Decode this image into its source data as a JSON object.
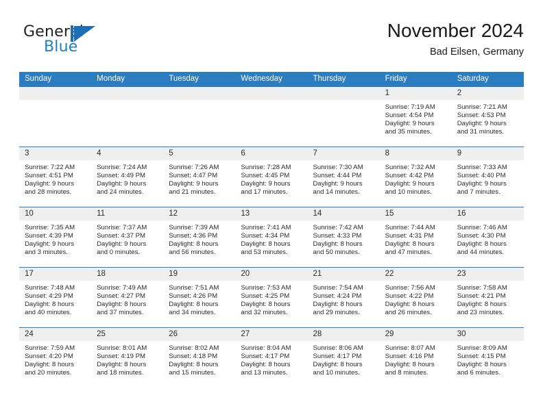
{
  "brand": {
    "name_part1": "General",
    "name_part2": "Blue",
    "mark": "triangle-flag-logo"
  },
  "header": {
    "title": "November 2024",
    "subtitle": "Bad Eilsen, Germany"
  },
  "colors": {
    "header_blue": "#2c7cc0",
    "day_header_gray": "#efefef",
    "brand_blue": "#1c7fc4",
    "text": "#2a2a2a"
  },
  "weekday_headers": [
    "Sunday",
    "Monday",
    "Tuesday",
    "Wednesday",
    "Thursday",
    "Friday",
    "Saturday"
  ],
  "weeks": [
    [
      {
        "date": "",
        "lines": []
      },
      {
        "date": "",
        "lines": []
      },
      {
        "date": "",
        "lines": []
      },
      {
        "date": "",
        "lines": []
      },
      {
        "date": "",
        "lines": []
      },
      {
        "date": "1",
        "lines": [
          "Sunrise: 7:19 AM",
          "Sunset: 4:54 PM",
          "Daylight: 9 hours",
          "and 35 minutes."
        ]
      },
      {
        "date": "2",
        "lines": [
          "Sunrise: 7:21 AM",
          "Sunset: 4:53 PM",
          "Daylight: 9 hours",
          "and 31 minutes."
        ]
      }
    ],
    [
      {
        "date": "3",
        "lines": [
          "Sunrise: 7:22 AM",
          "Sunset: 4:51 PM",
          "Daylight: 9 hours",
          "and 28 minutes."
        ]
      },
      {
        "date": "4",
        "lines": [
          "Sunrise: 7:24 AM",
          "Sunset: 4:49 PM",
          "Daylight: 9 hours",
          "and 24 minutes."
        ]
      },
      {
        "date": "5",
        "lines": [
          "Sunrise: 7:26 AM",
          "Sunset: 4:47 PM",
          "Daylight: 9 hours",
          "and 21 minutes."
        ]
      },
      {
        "date": "6",
        "lines": [
          "Sunrise: 7:28 AM",
          "Sunset: 4:45 PM",
          "Daylight: 9 hours",
          "and 17 minutes."
        ]
      },
      {
        "date": "7",
        "lines": [
          "Sunrise: 7:30 AM",
          "Sunset: 4:44 PM",
          "Daylight: 9 hours",
          "and 14 minutes."
        ]
      },
      {
        "date": "8",
        "lines": [
          "Sunrise: 7:32 AM",
          "Sunset: 4:42 PM",
          "Daylight: 9 hours",
          "and 10 minutes."
        ]
      },
      {
        "date": "9",
        "lines": [
          "Sunrise: 7:33 AM",
          "Sunset: 4:40 PM",
          "Daylight: 9 hours",
          "and 7 minutes."
        ]
      }
    ],
    [
      {
        "date": "10",
        "lines": [
          "Sunrise: 7:35 AM",
          "Sunset: 4:39 PM",
          "Daylight: 9 hours",
          "and 3 minutes."
        ]
      },
      {
        "date": "11",
        "lines": [
          "Sunrise: 7:37 AM",
          "Sunset: 4:37 PM",
          "Daylight: 9 hours",
          "and 0 minutes."
        ]
      },
      {
        "date": "12",
        "lines": [
          "Sunrise: 7:39 AM",
          "Sunset: 4:36 PM",
          "Daylight: 8 hours",
          "and 56 minutes."
        ]
      },
      {
        "date": "13",
        "lines": [
          "Sunrise: 7:41 AM",
          "Sunset: 4:34 PM",
          "Daylight: 8 hours",
          "and 53 minutes."
        ]
      },
      {
        "date": "14",
        "lines": [
          "Sunrise: 7:42 AM",
          "Sunset: 4:33 PM",
          "Daylight: 8 hours",
          "and 50 minutes."
        ]
      },
      {
        "date": "15",
        "lines": [
          "Sunrise: 7:44 AM",
          "Sunset: 4:31 PM",
          "Daylight: 8 hours",
          "and 47 minutes."
        ]
      },
      {
        "date": "16",
        "lines": [
          "Sunrise: 7:46 AM",
          "Sunset: 4:30 PM",
          "Daylight: 8 hours",
          "and 44 minutes."
        ]
      }
    ],
    [
      {
        "date": "17",
        "lines": [
          "Sunrise: 7:48 AM",
          "Sunset: 4:29 PM",
          "Daylight: 8 hours",
          "and 40 minutes."
        ]
      },
      {
        "date": "18",
        "lines": [
          "Sunrise: 7:49 AM",
          "Sunset: 4:27 PM",
          "Daylight: 8 hours",
          "and 37 minutes."
        ]
      },
      {
        "date": "19",
        "lines": [
          "Sunrise: 7:51 AM",
          "Sunset: 4:26 PM",
          "Daylight: 8 hours",
          "and 34 minutes."
        ]
      },
      {
        "date": "20",
        "lines": [
          "Sunrise: 7:53 AM",
          "Sunset: 4:25 PM",
          "Daylight: 8 hours",
          "and 32 minutes."
        ]
      },
      {
        "date": "21",
        "lines": [
          "Sunrise: 7:54 AM",
          "Sunset: 4:24 PM",
          "Daylight: 8 hours",
          "and 29 minutes."
        ]
      },
      {
        "date": "22",
        "lines": [
          "Sunrise: 7:56 AM",
          "Sunset: 4:22 PM",
          "Daylight: 8 hours",
          "and 26 minutes."
        ]
      },
      {
        "date": "23",
        "lines": [
          "Sunrise: 7:58 AM",
          "Sunset: 4:21 PM",
          "Daylight: 8 hours",
          "and 23 minutes."
        ]
      }
    ],
    [
      {
        "date": "24",
        "lines": [
          "Sunrise: 7:59 AM",
          "Sunset: 4:20 PM",
          "Daylight: 8 hours",
          "and 20 minutes."
        ]
      },
      {
        "date": "25",
        "lines": [
          "Sunrise: 8:01 AM",
          "Sunset: 4:19 PM",
          "Daylight: 8 hours",
          "and 18 minutes."
        ]
      },
      {
        "date": "26",
        "lines": [
          "Sunrise: 8:02 AM",
          "Sunset: 4:18 PM",
          "Daylight: 8 hours",
          "and 15 minutes."
        ]
      },
      {
        "date": "27",
        "lines": [
          "Sunrise: 8:04 AM",
          "Sunset: 4:17 PM",
          "Daylight: 8 hours",
          "and 13 minutes."
        ]
      },
      {
        "date": "28",
        "lines": [
          "Sunrise: 8:06 AM",
          "Sunset: 4:17 PM",
          "Daylight: 8 hours",
          "and 10 minutes."
        ]
      },
      {
        "date": "29",
        "lines": [
          "Sunrise: 8:07 AM",
          "Sunset: 4:16 PM",
          "Daylight: 8 hours",
          "and 8 minutes."
        ]
      },
      {
        "date": "30",
        "lines": [
          "Sunrise: 8:09 AM",
          "Sunset: 4:15 PM",
          "Daylight: 8 hours",
          "and 6 minutes."
        ]
      }
    ]
  ]
}
